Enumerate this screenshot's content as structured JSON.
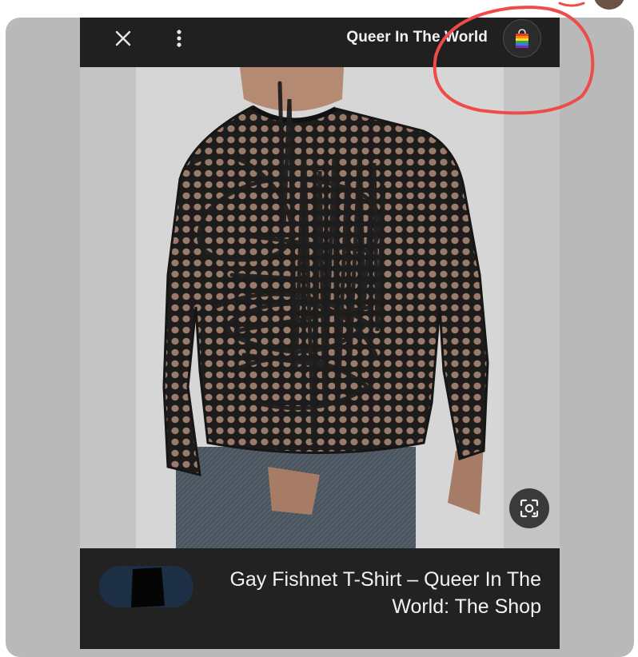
{
  "header": {
    "site_name": "Queer In The World"
  },
  "icons": {
    "close": "close-icon",
    "more": "more-vert-icon",
    "favicon": "rainbow-shopping-bag-icon",
    "lens": "google-lens-icon"
  },
  "image": {
    "subject": "fishnet-long-sleeve-shirt-photo",
    "scribble_color": "#1e1e1e",
    "annotation_color": "#ef4b4b"
  },
  "caption": {
    "title": "Gay Fishnet T-Shirt – Queer In The World: The Shop",
    "thumbnail_redacted": true
  },
  "colors": {
    "card_bg": "#b9b9b9",
    "bar_bg": "#202020",
    "text": "#f1f1f1"
  }
}
